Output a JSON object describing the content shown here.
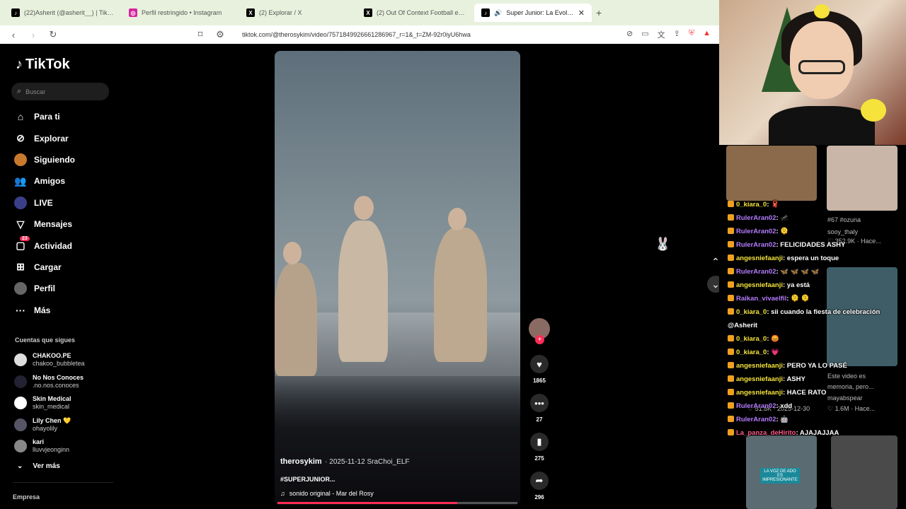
{
  "browser": {
    "tabs": [
      {
        "label": "(22)Asherit (@asherit__) | TikTok",
        "icon": "tiktok-icon",
        "active": false
      },
      {
        "label": "Perfil restringido • Instagram",
        "icon": "instagram-icon",
        "active": false
      },
      {
        "label": "(2) Explorar / X",
        "icon": "x-icon",
        "active": false
      },
      {
        "label": "(2) Out Of Context Football en X: \"htt",
        "icon": "x-icon",
        "active": false
      },
      {
        "label": "Super Junior: La Evolución de",
        "icon": "tiktok-icon",
        "active": true
      }
    ],
    "new_tab": "+",
    "url": "tiktok.com/@therosykim/video/7571849926661286967_r=1&_t=ZM-92r0iyU6hwa"
  },
  "tiktok": {
    "logo": "TikTok",
    "search_placeholder": "Buscar",
    "nav": [
      {
        "label": "Para ti",
        "icon": "home-icon"
      },
      {
        "label": "Explorar",
        "icon": "compass-icon"
      },
      {
        "label": "Siguiendo",
        "icon": "following-avatar"
      },
      {
        "label": "Amigos",
        "icon": "friends-icon"
      },
      {
        "label": "LIVE",
        "icon": "live-avatar"
      },
      {
        "label": "Mensajes",
        "icon": "send-icon"
      },
      {
        "label": "Actividad",
        "icon": "inbox-icon",
        "badge": "23"
      },
      {
        "label": "Cargar",
        "icon": "plus-square-icon"
      },
      {
        "label": "Perfil",
        "icon": "profile-avatar"
      },
      {
        "label": "Más",
        "icon": "more-icon"
      }
    ],
    "follows_title": "Cuentas que sigues",
    "follows": [
      {
        "name": "CHAKOO.PE",
        "handle": "chakoo_bubbletea"
      },
      {
        "name": "No Nos Conoces",
        "handle": ".no.nos.conoces"
      },
      {
        "name": "Skin Medical",
        "handle": "skin_medical"
      },
      {
        "name": "Lily Chen 💛",
        "handle": "ohayolily"
      },
      {
        "name": "kari",
        "handle": "lluvvjeonginn"
      }
    ],
    "ver_mas": "Ver más",
    "empresa": "Empresa"
  },
  "video": {
    "username": "therosykim",
    "date": "· 2025-11-12 SraChoi_ELF",
    "hashtag": "#SUPERJUNIOR...",
    "sound": "sonido original - Mar del Rosy",
    "progress": 0.75,
    "actions": [
      {
        "icon": "heart-icon",
        "count": "1865"
      },
      {
        "icon": "comment-icon",
        "count": "27"
      },
      {
        "icon": "bookmark-icon",
        "count": "275"
      },
      {
        "icon": "share-icon",
        "count": "296"
      }
    ]
  },
  "stream": {
    "chat": [
      {
        "user": "0_kiara_0",
        "text": ": 🧣",
        "color": "#f5e33b"
      },
      {
        "user": "RulerAran02",
        "text": ": 🦟",
        "color": "#b47cff"
      },
      {
        "user": "RulerAran02",
        "text": ": 🫠",
        "color": "#b47cff"
      },
      {
        "user": "RulerAran02",
        "text": ": FELICIDADES ASHY",
        "color": "#b47cff"
      },
      {
        "user": "angesniefaanji",
        "text": ": espera un toque",
        "color": "#f5e33b"
      },
      {
        "user": "RulerAran02",
        "text": ": 🦋 🦋 🦋 🦋",
        "color": "#b47cff"
      },
      {
        "user": "angesniefaanji",
        "text": ": ya está",
        "color": "#f5e33b"
      },
      {
        "user": "Raikan_vivaelfil",
        "text": ": 🫠 🫠",
        "color": "#b47cff"
      },
      {
        "user": "0_kiara_0",
        "text": ": sii cuando la fiesta de celebración",
        "color": "#f5e33b"
      },
      {
        "user": "",
        "text": "@Asherit",
        "color": "#ffffff"
      },
      {
        "user": "0_kiara_0",
        "text": ": 😡",
        "color": "#f5e33b"
      },
      {
        "user": "0_kiara_0",
        "text": ": 💗",
        "color": "#f5e33b"
      },
      {
        "user": "angesniefaanji",
        "text": ": PERO YA LO PASÉ",
        "color": "#f5e33b"
      },
      {
        "user": "angesniefaanji",
        "text": ": ASHY",
        "color": "#f5e33b"
      },
      {
        "user": "angesniefaanji",
        "text": ": HACE RATO",
        "color": "#f5e33b"
      },
      {
        "user": "RulerAran02",
        "text": ": xdd",
        "color": "#b47cff"
      },
      {
        "user": "RulerAran02",
        "text": ": 🤖",
        "color": "#b47cff"
      },
      {
        "user": "La_panza_deHirito",
        "text": ": AJAJAJJAA",
        "color": "#ff5c8a"
      }
    ],
    "ghost_text": [
      {
        "text": "#67 #ozuna"
      },
      {
        "text": "sooy_thaly"
      },
      {
        "text": "♡ 352.9K · Hace..."
      },
      {
        "text": "Este video es"
      },
      {
        "text": "memoria, pero..."
      },
      {
        "text": "mayabspear"
      },
      {
        "text": "♡ 51.8K · 2025-12-30"
      },
      {
        "text": "♡ 1.6M · Hace..."
      },
      {
        "text": "LA VOZ DE ADO ES IMPRESIONANTE"
      }
    ]
  }
}
